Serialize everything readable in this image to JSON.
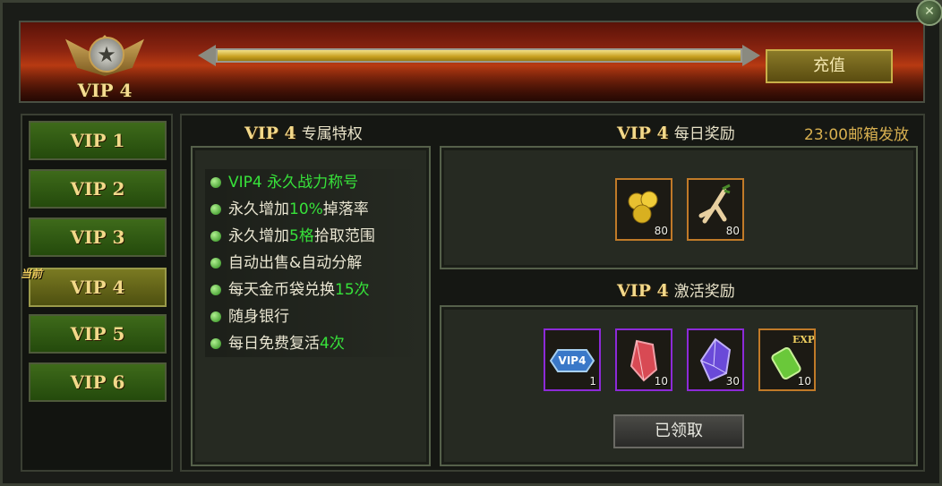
{
  "header": {
    "vip_badge": "VIP 4",
    "progress": 1.0,
    "recharge_label": "充值"
  },
  "tabs": [
    {
      "label": "VIP 1"
    },
    {
      "label": "VIP 2"
    },
    {
      "label": "VIP 3"
    },
    {
      "label": "VIP 4",
      "current_tag": "当前"
    },
    {
      "label": "VIP 5"
    },
    {
      "label": "VIP 6"
    }
  ],
  "privileges": {
    "title_vip": "VIP 4",
    "title_text": "专属特权",
    "items": [
      {
        "parts": [
          "VIP4 永久战力称号"
        ],
        "highlight": [
          true
        ]
      },
      {
        "parts": [
          "永久增加",
          "10%",
          "掉落率"
        ],
        "highlight": [
          false,
          true,
          false
        ]
      },
      {
        "parts": [
          "永久增加",
          "5格",
          "拾取范围"
        ],
        "highlight": [
          false,
          true,
          false
        ]
      },
      {
        "parts": [
          "自动出售&自动分解"
        ],
        "highlight": [
          false
        ]
      },
      {
        "parts": [
          "每天金币袋兑换",
          "15次"
        ],
        "highlight": [
          false,
          true
        ]
      },
      {
        "parts": [
          "随身银行"
        ],
        "highlight": [
          false
        ]
      },
      {
        "parts": [
          "每日免费复活",
          "4次"
        ],
        "highlight": [
          false,
          true
        ]
      }
    ]
  },
  "daily": {
    "title_vip": "VIP 4",
    "title_text": "每日奖励",
    "mail_note": "23:00邮箱发放",
    "items": [
      {
        "icon": "gold-beans-icon",
        "count": "80"
      },
      {
        "icon": "ginseng-root-icon",
        "count": "80"
      }
    ]
  },
  "activation": {
    "title_vip": "VIP 4",
    "title_text": "激活奖励",
    "items": [
      {
        "icon": "vip4-title-badge-icon",
        "label": "VIP4",
        "count": "1"
      },
      {
        "icon": "red-crystal-icon",
        "count": "10"
      },
      {
        "icon": "purple-crystal-icon",
        "count": "30"
      },
      {
        "icon": "exp-potion-icon",
        "label": "EXP",
        "count": "10"
      }
    ],
    "claimed_label": "已领取"
  }
}
